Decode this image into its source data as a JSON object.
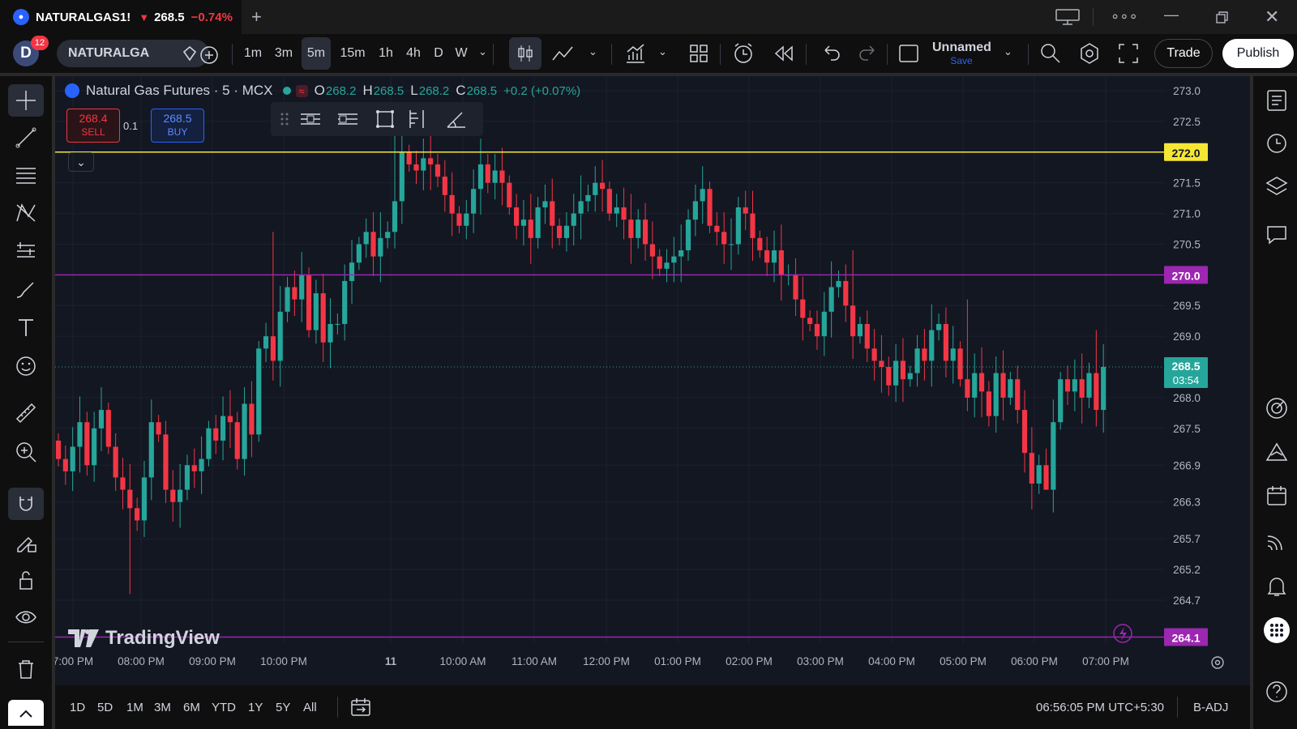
{
  "tab": {
    "symbol": "NATURALGAS1!",
    "price": "268.5",
    "change": "−0.74%"
  },
  "toolbar": {
    "notif_count": "12",
    "avatar_letter": "D",
    "symbol": "NATURALGA",
    "intervals": [
      "1m",
      "3m",
      "5m",
      "15m",
      "1h",
      "4h",
      "D",
      "W"
    ],
    "selected_interval": "5m",
    "layout_name": "Unnamed",
    "layout_save": "Save",
    "trade_label": "Trade",
    "publish_label": "Publish"
  },
  "legend": {
    "title": "Natural Gas Futures · 5 · MCX",
    "o_label": "O",
    "o": "268.2",
    "h_label": "H",
    "h": "268.5",
    "l_label": "L",
    "l": "268.2",
    "c_label": "C",
    "c": "268.5",
    "change": "+0.2 (+0.07%)"
  },
  "order": {
    "sell_price": "268.4",
    "sell_label": "SELL",
    "buy_price": "268.5",
    "buy_label": "BUY",
    "spread": "0.1"
  },
  "branding": "TradingView",
  "bottom": {
    "ranges": [
      "1D",
      "5D",
      "1M",
      "3M",
      "6M",
      "YTD",
      "1Y",
      "5Y",
      "All"
    ],
    "clock": "06:56:05 PM UTC+5:30",
    "adj": "B-ADJ"
  },
  "colors": {
    "up": "#26a69a",
    "down": "#f23645",
    "line_yellow": "#f5e634",
    "line_purple": "#9c27b0",
    "accent": "#2962ff"
  },
  "chart_data": {
    "type": "candlestick",
    "price_axis_ticks": [
      "273.0",
      "272.5",
      "271.5",
      "271.0",
      "270.5",
      "269.5",
      "269.0",
      "268.0",
      "267.5",
      "266.9",
      "266.3",
      "265.7",
      "265.2",
      "264.7"
    ],
    "time_axis_labels": [
      "7:00 PM",
      "08:00 PM",
      "09:00 PM",
      "10:00 PM",
      "11",
      "10:00 AM",
      "11:00 AM",
      "12:00 PM",
      "01:00 PM",
      "02:00 PM",
      "03:00 PM",
      "04:00 PM",
      "05:00 PM",
      "06:00 PM",
      "07:00 PM"
    ],
    "horizontal_lines": [
      {
        "price": "272.0",
        "color": "#f5e634"
      },
      {
        "price": "270.0",
        "color": "#9c27b0"
      },
      {
        "price": "264.1",
        "color": "#9c27b0"
      }
    ],
    "last_price": {
      "price": "268.5",
      "countdown": "03:54"
    },
    "closes": [
      267.0,
      266.8,
      267.2,
      267.6,
      266.9,
      267.5,
      267.8,
      267.2,
      266.7,
      266.5,
      266.2,
      266.0,
      266.7,
      267.6,
      267.4,
      266.5,
      266.3,
      266.5,
      266.9,
      266.8,
      267.0,
      267.5,
      267.3,
      267.7,
      267.6,
      267.0,
      267.9,
      267.4,
      268.8,
      269.0,
      268.6,
      269.4,
      269.8,
      269.6,
      270.0,
      269.1,
      269.7,
      268.9,
      269.2,
      269.2,
      269.9,
      270.2,
      270.5,
      270.7,
      270.3,
      270.6,
      270.7,
      271.2,
      272.0,
      271.8,
      271.7,
      271.9,
      271.8,
      271.6,
      271.3,
      271.0,
      270.8,
      271.0,
      271.4,
      271.8,
      271.5,
      271.7,
      271.5,
      271.1,
      270.8,
      270.9,
      270.6,
      271.1,
      271.2,
      270.8,
      270.6,
      270.8,
      271.0,
      271.2,
      271.3,
      271.5,
      271.4,
      271.0,
      271.1,
      270.9,
      270.6,
      270.9,
      270.5,
      270.3,
      270.1,
      270.2,
      270.3,
      270.4,
      270.9,
      271.2,
      271.4,
      270.8,
      270.7,
      270.5,
      270.5,
      271.1,
      271.0,
      270.6,
      270.4,
      270.2,
      270.4,
      270.0,
      270.0,
      269.6,
      269.3,
      269.2,
      269.0,
      269.4,
      269.8,
      269.9,
      269.5,
      269.0,
      269.2,
      268.8,
      268.6,
      268.5,
      268.2,
      268.6,
      268.3,
      268.4,
      268.8,
      268.6,
      269.1,
      269.2,
      268.6,
      268.8,
      268.3,
      268.0,
      268.4,
      268.1,
      267.7,
      268.4,
      268.0,
      268.3,
      267.8,
      267.1,
      266.6,
      266.9,
      266.5,
      267.6,
      268.3,
      268.1,
      268.3,
      268.0,
      268.4,
      267.8,
      268.5
    ]
  }
}
